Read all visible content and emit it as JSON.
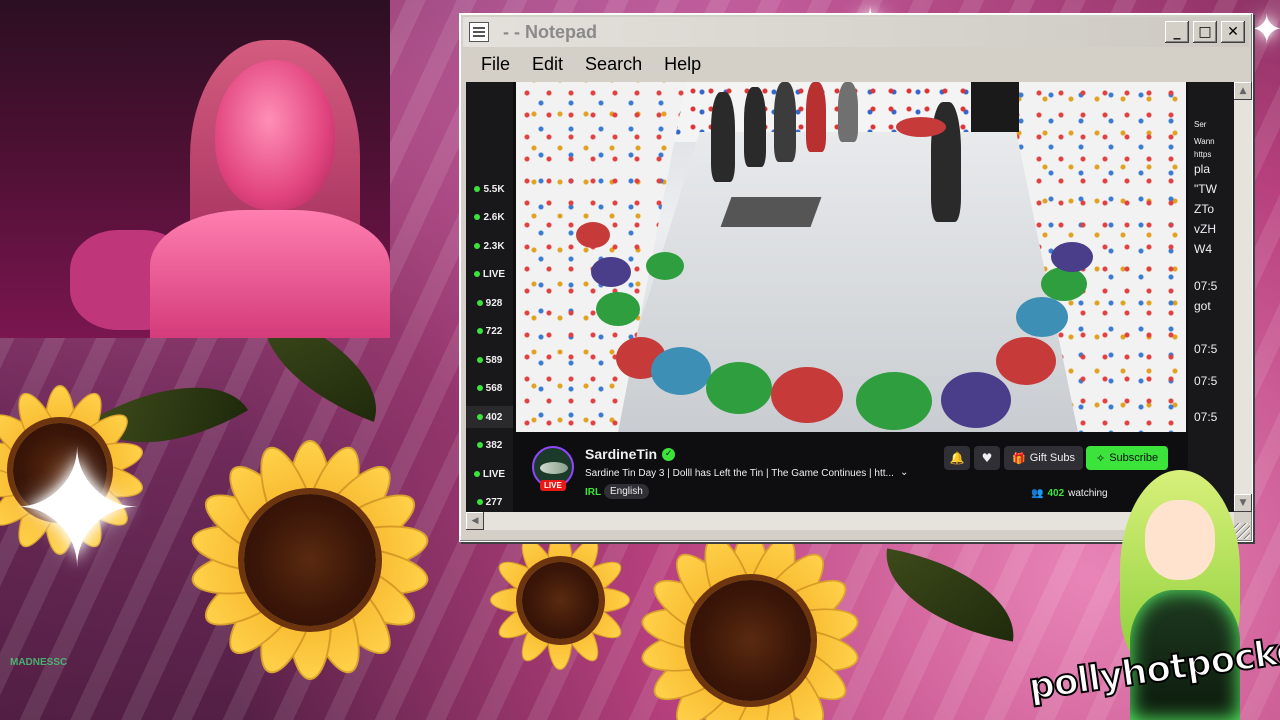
{
  "notepad": {
    "title": "- - Notepad",
    "menu": [
      {
        "label": "File"
      },
      {
        "label": "Edit"
      },
      {
        "label": "Search"
      },
      {
        "label": "Help"
      }
    ],
    "controls": {
      "minimize": "_",
      "maximize": "□",
      "close": "✕"
    }
  },
  "sidebar": {
    "items": [
      {
        "label": "5.5K"
      },
      {
        "label": "2.6K"
      },
      {
        "label": "2.3K"
      },
      {
        "label": "LIVE"
      },
      {
        "label": "928"
      },
      {
        "label": "722"
      },
      {
        "label": "589"
      },
      {
        "label": "568"
      },
      {
        "label": "402"
      },
      {
        "label": "382"
      },
      {
        "label": "LIVE"
      },
      {
        "label": "277"
      }
    ]
  },
  "stream": {
    "channel_name": "SardineTin",
    "live_badge": "LIVE",
    "title": "Sardine Tin Day 3 | Dolll has Left the Tin | The Game Continues | htt...",
    "category": "IRL",
    "tag": "English",
    "gift_label": "Gift Subs",
    "subscribe_label": "Subscribe",
    "viewer_count": "402",
    "viewer_suffix": "watching"
  },
  "chat": {
    "lines": [
      "pla",
      "\"TW",
      "ZTo",
      "vZH",
      "W4",
      "07:5",
      "got",
      "07:5",
      "07:5",
      "07:5"
    ],
    "small": [
      "Ser",
      "Wann",
      "https"
    ]
  },
  "colors": {
    "twitch_green": "#3be33b",
    "twitch_purple": "#9147ff",
    "twitch_bg": "#0e0e10"
  },
  "overlay": {
    "chat_handle": "MADNESSC",
    "brand": "pollyhotpocket"
  }
}
